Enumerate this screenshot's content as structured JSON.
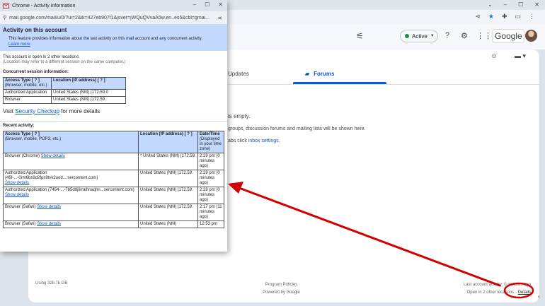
{
  "background": {
    "status": {
      "label": "Active"
    },
    "brand": "Google",
    "tabs": {
      "updates": "Updates",
      "forums": "Forums"
    },
    "empty": {
      "line1": "is empty.",
      "line2": "groups, discussion forums and mailing lists will be shown here.",
      "line3_prefix": "abs click ",
      "line3_link": "inbox settings",
      "line3_suffix": "."
    },
    "footer": {
      "storage": "Using 328.7k GB",
      "policies": "Program Policies",
      "powered": "Powered by Google",
      "last_activity": "Last account activity: 0 minutes ago",
      "open_in": "Open in 2 other locations · ",
      "details": "Details"
    }
  },
  "popup": {
    "window_title": "Chrome - Activity information",
    "url": "mail.google.com/mail/u/0/?ui=2&ik=427eb907f1&jsver=jWQuQVvaA5w.en..es5&cbl=gmai...",
    "heading": "Activity on this account",
    "intro": "This feature provides information about the last activity on this mail account and any concurrent activity.",
    "learn_more": "Learn more",
    "open_locations": "This account is open in 2 other locations.",
    "location_note": "(Location may refer to a different session on the same computer.)",
    "concurrent_title": "Concurrent session information:",
    "concurrent_headers": {
      "type": "Access Type [ ? ]",
      "type_sub": "(Browser, mobile, etc.)",
      "location": "Location (IP address) [ ? ]"
    },
    "concurrent_rows": [
      {
        "type": "Authorized Application",
        "location": "United States (NM) (172.59.0"
      },
      {
        "type": "Browser",
        "location": "United States (NM) (172.59."
      }
    ],
    "visit_prefix": "Visit ",
    "visit_link": "Security Checkup",
    "visit_suffix": " for more details",
    "recent_title": "Recent activity:",
    "recent_headers": {
      "type": "Access Type [ ? ]",
      "type_sub": "(Browser, mobile, POP3, etc.)",
      "location": "Location (IP address) [ ? ]",
      "datetime": "Date/Time",
      "datetime_sub": "(Displayed in your time zone)"
    },
    "recent_rows": [
      {
        "type": "Browser (Chrome)",
        "show": "Show details",
        "location": "* United States (NM) (172.59.",
        "time": "2:29 pm (0 minutes ago)"
      },
      {
        "type": "Authorized Application (45f-...-0rm6bs9d2fps9tvk2ood....sercontent.com)",
        "show": "Show details",
        "location": "United States (NM) (172.59.",
        "time": "2:29 pm (0 minutes ago)"
      },
      {
        "type": "Authorized Application (7454-...-7b5d8jlirraihnaqhn...sercontent.com)",
        "show": "Show details",
        "location": "United States (NM) (172.59.",
        "time": "2:28 pm (0 minutes ago)"
      },
      {
        "type": "Browser (Safari)",
        "show": "Show details",
        "location": "United States (NM) (172.59.",
        "time": "2:17 pm (11 minutes ago)"
      },
      {
        "type": "Browser (Safari)",
        "show": "Show details",
        "location": "United States (NM)",
        "time": "12:53 pm"
      }
    ]
  },
  "colors": {
    "annotation": "#d40000",
    "link": "#1155cc",
    "header_blue": "#c3d9ff",
    "active_green": "#1e8e3e"
  }
}
